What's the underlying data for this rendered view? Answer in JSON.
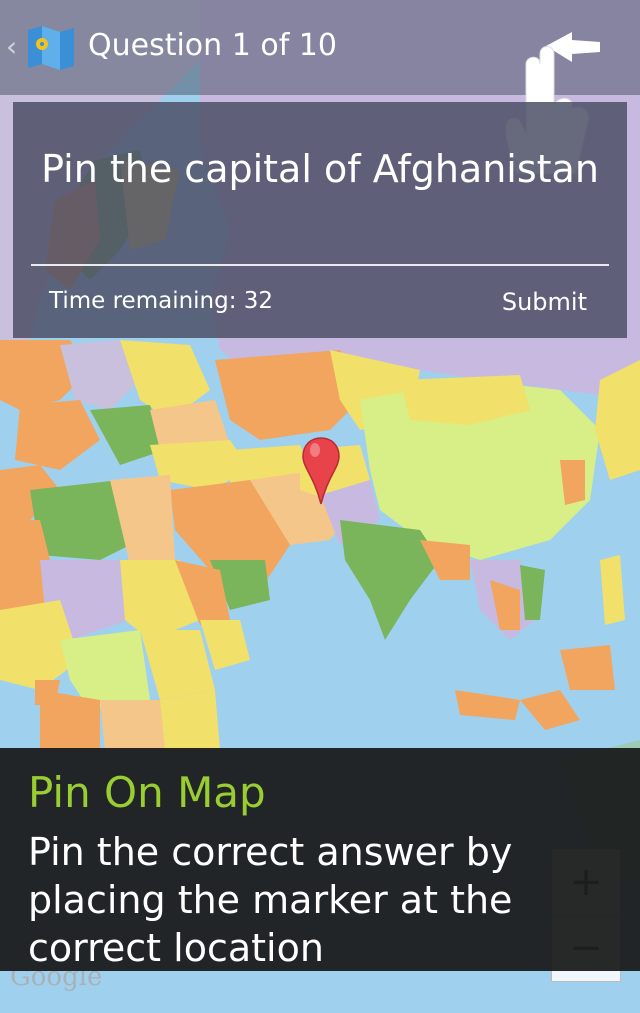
{
  "action_bar": {
    "up_glyph": "‹",
    "app_icon": "map-pin-icon",
    "title": "Question 1 of 10",
    "gesture_icon": "swipe-back-hand-icon"
  },
  "card": {
    "question": "Pin the capital of Afghanistan",
    "timer_label": "Time remaining: 32",
    "submit_label": "Submit"
  },
  "map": {
    "marker_icon": "red-map-marker-icon",
    "attribution": "Google",
    "zoom_in_label": "+",
    "zoom_out_label": "−"
  },
  "tutorial": {
    "title": "Pin On Map",
    "body": "Pin the correct answer by placing the marker at the correct location"
  },
  "colors": {
    "ocean": "#9fd1ef",
    "accent_green": "#9acd32",
    "card_bg": "#4e5068",
    "marker_red": "#e8434a"
  }
}
